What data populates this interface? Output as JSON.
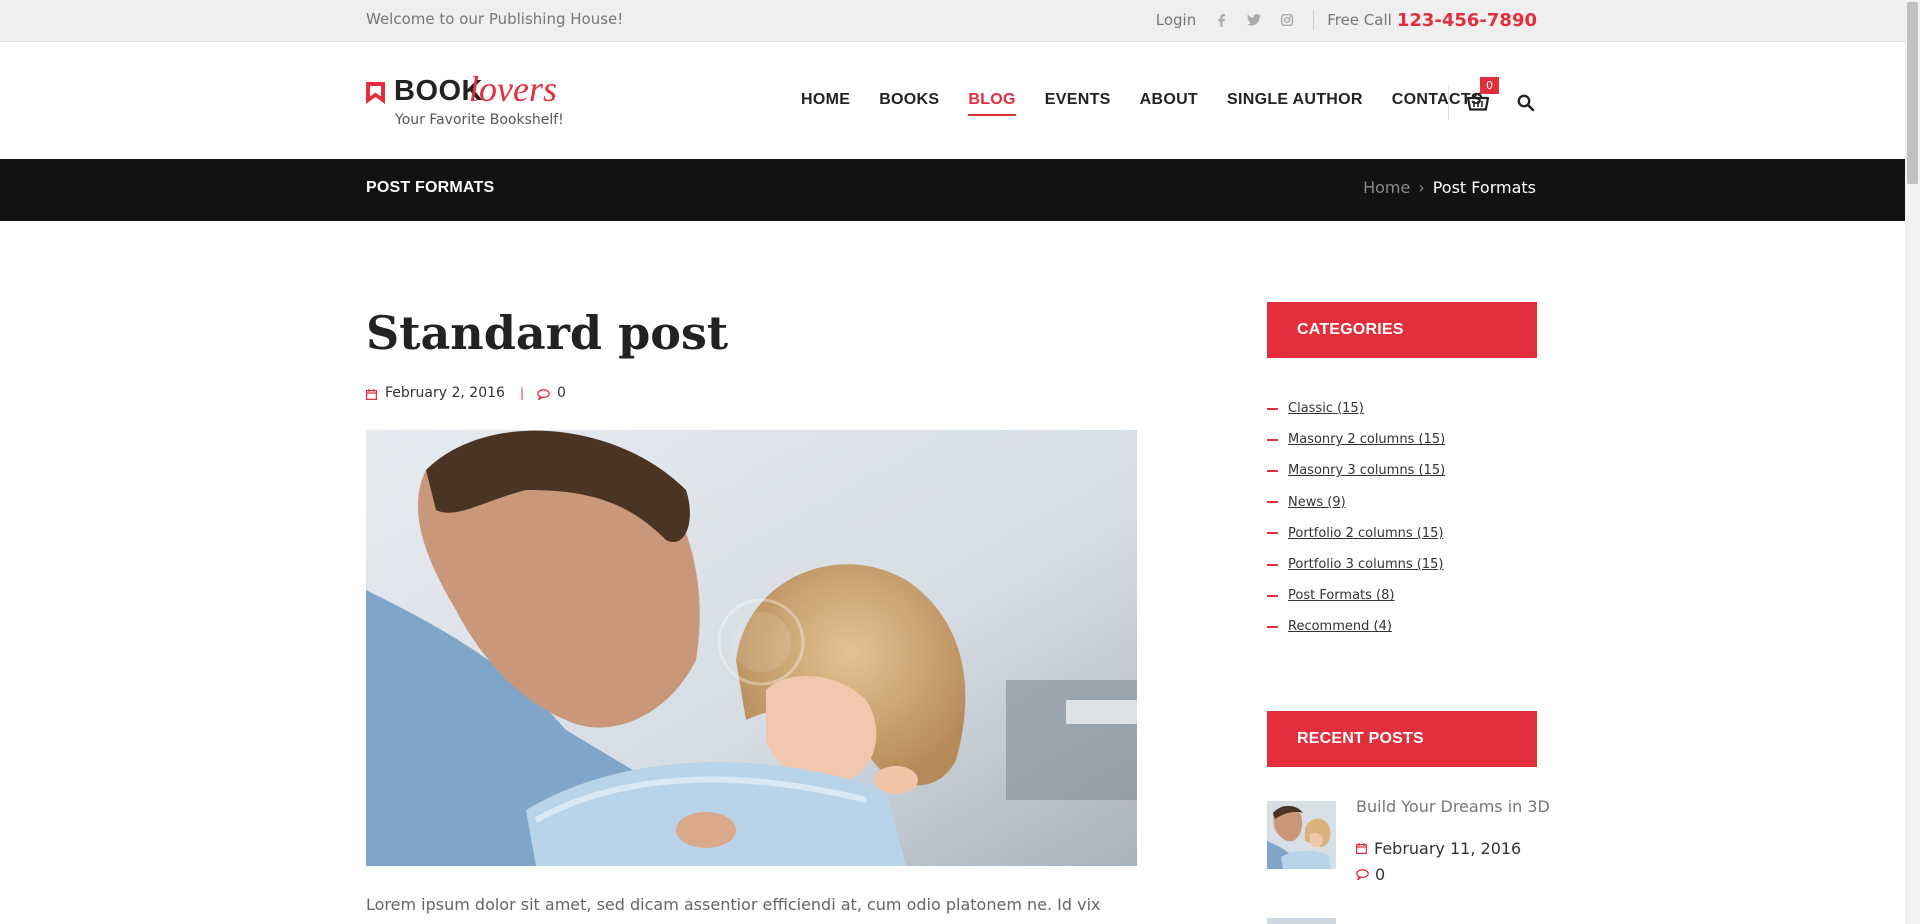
{
  "topbar": {
    "welcome": "Welcome to our Publishing House!",
    "login": "Login",
    "social_icons": [
      "facebook-icon",
      "twitter-icon",
      "instagram-icon"
    ],
    "free_call_label": "Free Call",
    "phone": "123-456-7890"
  },
  "logo": {
    "word_book": "BOOK",
    "word_lovers": "lovers",
    "tagline": "Your Favorite Bookshelf!"
  },
  "nav": {
    "items": [
      "HOME",
      "BOOKS",
      "BLOG",
      "EVENTS",
      "ABOUT",
      "SINGLE AUTHOR",
      "CONTACTS"
    ],
    "active": "BLOG",
    "cart_count": "0"
  },
  "titlebar": {
    "title": "POST FORMATS",
    "breadcrumb_home": "Home",
    "breadcrumb_separator": "›",
    "breadcrumb_current": "Post Formats"
  },
  "post": {
    "title": "Standard post",
    "date": "February 2, 2016",
    "separator": "|",
    "comments": "0",
    "excerpt": "Lorem ipsum dolor sit amet, sed dicam assentior efficiendi at, cum odio platonem ne. Id vix commune"
  },
  "sidebar": {
    "categories_title": "CATEGORIES",
    "categories": [
      "Classic (15)",
      "Masonry 2 columns (15)",
      "Masonry 3 columns (15)",
      "News (9)",
      "Portfolio 2 columns (15)",
      "Portfolio 3 columns (15)",
      "Post Formats (8)",
      "Recommend (4)"
    ],
    "recent_title": "RECENT POSTS",
    "recent_posts": [
      {
        "title": "Build Your Dreams in 3D",
        "date": "February 11, 2016",
        "comments": "0"
      }
    ]
  },
  "colors": {
    "accent": "#e32e3d",
    "dark_bar": "#121212",
    "topbar_bg": "#efefef"
  }
}
